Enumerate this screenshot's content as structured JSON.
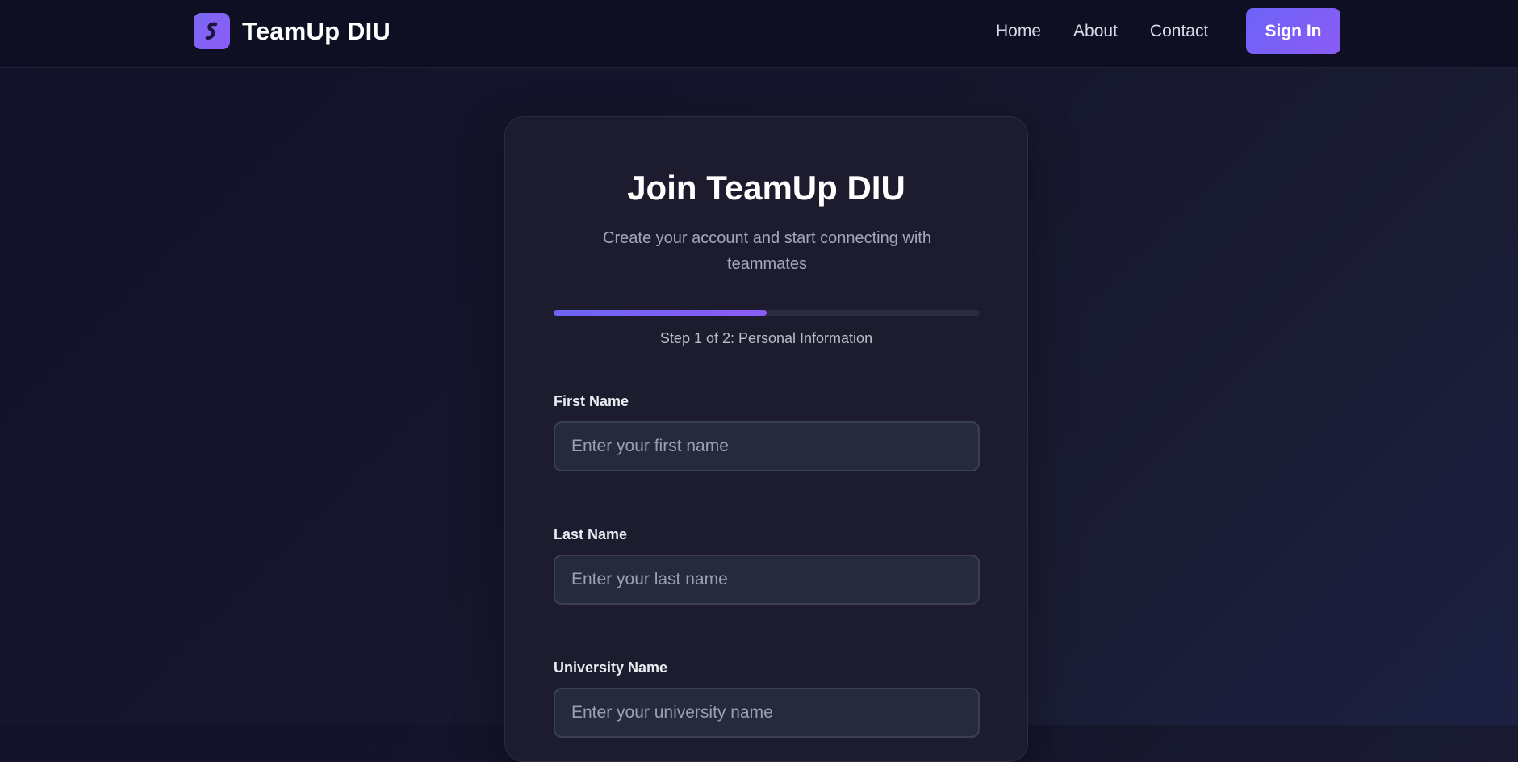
{
  "header": {
    "brand": "TeamUp DIU",
    "logo_icon": "s-logo-icon",
    "nav": [
      {
        "label": "Home"
      },
      {
        "label": "About"
      },
      {
        "label": "Contact"
      }
    ],
    "signin_label": "Sign In"
  },
  "form": {
    "title": "Join TeamUp DIU",
    "subtitle": "Create your account and start connecting with teammates",
    "progress": 0.5,
    "step_text": "Step 1 of 2: Personal Information",
    "fields": [
      {
        "label": "First Name",
        "placeholder": "Enter your first name",
        "value": ""
      },
      {
        "label": "Last Name",
        "placeholder": "Enter your last name",
        "value": ""
      },
      {
        "label": "University Name",
        "placeholder": "Enter your university name",
        "value": ""
      }
    ]
  },
  "colors": {
    "accent": "#7b68f5",
    "background": "#13142a",
    "card": "#1c1c2e"
  }
}
